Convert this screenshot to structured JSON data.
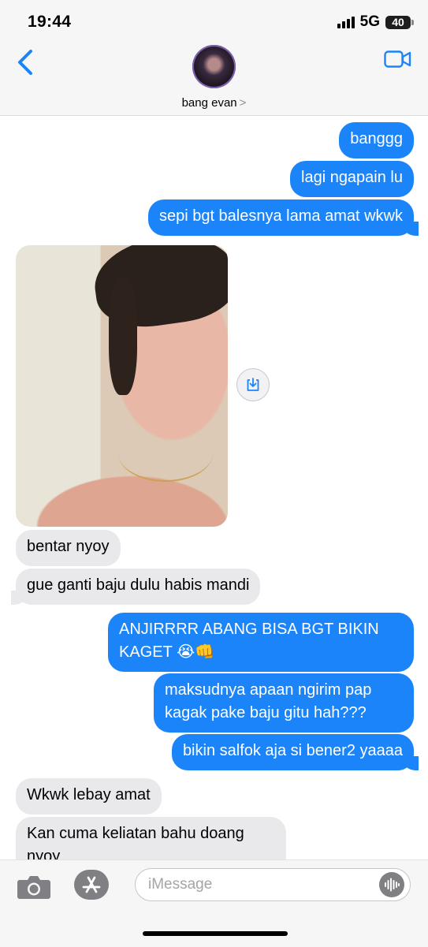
{
  "status_bar": {
    "time": "19:44",
    "network": "5G",
    "battery": "40"
  },
  "header": {
    "contact_name": "bang evan",
    "chevron": ">"
  },
  "messages": [
    {
      "from": "me",
      "text": "banggg"
    },
    {
      "from": "me",
      "text": "lagi ngapain lu"
    },
    {
      "from": "me",
      "text": "sepi bgt balesnya lama amat wkwk"
    },
    {
      "from": "them",
      "type": "photo"
    },
    {
      "from": "them",
      "text": "bentar nyoy"
    },
    {
      "from": "them",
      "text": "gue ganti baju dulu habis mandi"
    },
    {
      "from": "me",
      "text": "ANJIRRRR ABANG BISA BGT BIKIN KAGET 😭👊"
    },
    {
      "from": "me",
      "text": "maksudnya apaan ngirim pap kagak pake baju gitu hah???"
    },
    {
      "from": "me",
      "text": "bikin salfok aja si bener2 yaaaa"
    },
    {
      "from": "them",
      "text": "Wkwk lebay amat"
    },
    {
      "from": "them",
      "text": "Kan cuma keliatan bahu doang nyoy"
    }
  ],
  "input_bar": {
    "placeholder": "iMessage"
  },
  "icons": {
    "back": "chevron-left-icon",
    "video": "video-camera-icon",
    "camera": "camera-icon",
    "apps": "app-store-icon",
    "audio": "audio-waveform-icon",
    "save": "save-image-icon"
  },
  "colors": {
    "outgoing": "#1b84f8",
    "incoming": "#e9e9eb",
    "accent": "#1b84f8"
  }
}
